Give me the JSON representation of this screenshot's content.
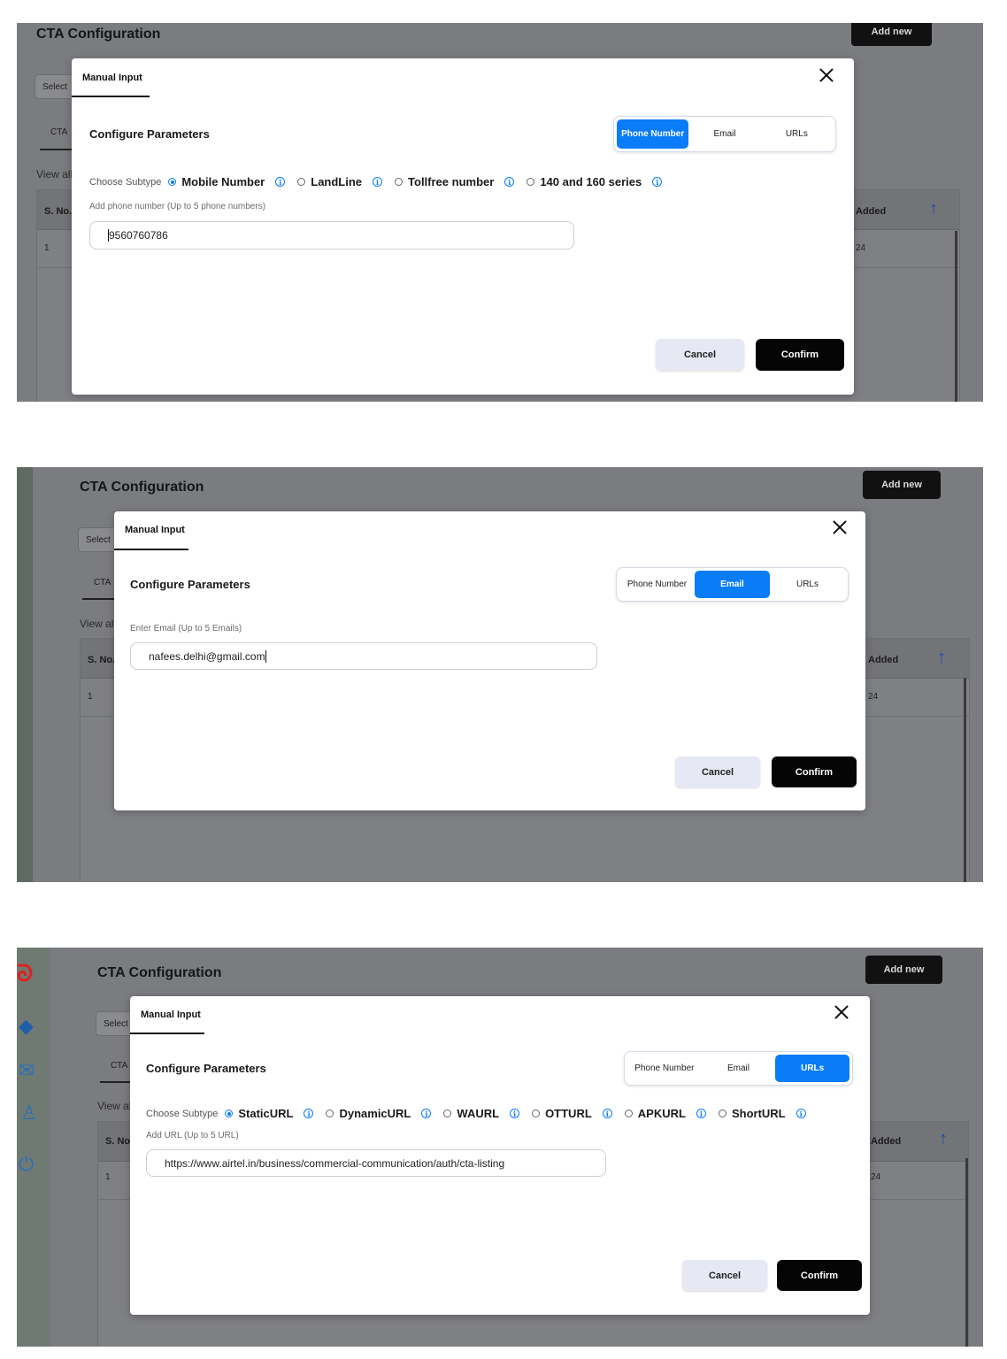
{
  "common": {
    "page_title": "CTA Configuration",
    "add_new": "Add new",
    "select_partial": "Select",
    "tab_partial": "CTA",
    "view_all_partial": "View al",
    "col_sno": "S. No.",
    "col_added": "Added",
    "row_sno": "1",
    "row_date_partial": "24",
    "modal_tab": "Manual Input",
    "configure_title": "Configure Parameters",
    "segments": [
      "Phone Number",
      "Email",
      "URLs"
    ],
    "choose_subtype": "Choose Subtype",
    "cancel": "Cancel",
    "confirm": "Confirm",
    "info_glyph": "i",
    "accent_color": "#0a7cf7"
  },
  "shot1": {
    "active_segment": "Phone Number",
    "subtypes": [
      "Mobile Number",
      "LandLine",
      "Tollfree number",
      "140 and 160 series"
    ],
    "selected_subtype": "Mobile Number",
    "field_label": "Add phone number (Up to 5 phone numbers)",
    "field_value": "9560760786",
    "view_all": "View all"
  },
  "shot2": {
    "active_segment": "Email",
    "field_label": "Enter Email (Up to 5 Emails)",
    "field_value": "nafees.delhi@gmail.com",
    "view_all": "View all",
    "select": "Select"
  },
  "shot3": {
    "active_segment": "URLs",
    "subtypes": [
      "StaticURL",
      "DynamicURL",
      "WAURL",
      "OTTURL",
      "APKURL",
      "ShortURL"
    ],
    "selected_subtype": "StaticURL",
    "field_label": "Add URL (Up to 5 URL)",
    "field_value": "https://www.airtel.in/business/commercial-communication/auth/cta-listing",
    "view_all": "View al"
  },
  "sidebar_icons": [
    "airtel-logo-icon",
    "diamond-icon",
    "message-icon",
    "user-icon",
    "power-icon"
  ]
}
